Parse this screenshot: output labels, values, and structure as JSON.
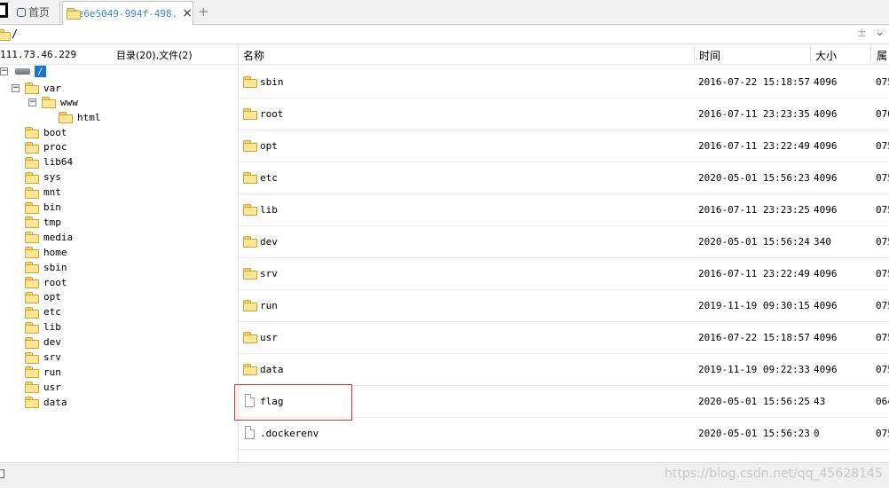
{
  "tabs": {
    "home_label": "首页",
    "active_label": "6e6e5049-994f-498.",
    "close_glyph": "×",
    "add_glyph": "+"
  },
  "path": {
    "value": "/",
    "plusminus_glyph": "±",
    "chevron_glyph": "⌄"
  },
  "left": {
    "server_ip": "111.73.46.229",
    "counts": "目录(20),文件(2)"
  },
  "tree": {
    "root": "/",
    "var": "var",
    "www": "www",
    "html": "html",
    "items": [
      "boot",
      "proc",
      "lib64",
      "sys",
      "mnt",
      "bin",
      "tmp",
      "media",
      "home",
      "sbin",
      "root",
      "opt",
      "etc",
      "lib",
      "dev",
      "srv",
      "run",
      "usr",
      "data"
    ]
  },
  "columns": {
    "name": "名称",
    "time": "时间",
    "size": "大小",
    "perm": "属"
  },
  "files": [
    {
      "name": "sbin",
      "type": "folder",
      "time": "2016-07-22 15:18:57",
      "size": "4096",
      "perm": "075"
    },
    {
      "name": "root",
      "type": "folder",
      "time": "2016-07-11 23:23:35",
      "size": "4096",
      "perm": "070"
    },
    {
      "name": "opt",
      "type": "folder",
      "time": "2016-07-11 23:22:49",
      "size": "4096",
      "perm": "075"
    },
    {
      "name": "etc",
      "type": "folder",
      "time": "2020-05-01 15:56:23",
      "size": "4096",
      "perm": "075"
    },
    {
      "name": "lib",
      "type": "folder",
      "time": "2016-07-11 23:23:25",
      "size": "4096",
      "perm": "075"
    },
    {
      "name": "dev",
      "type": "folder",
      "time": "2020-05-01 15:56:24",
      "size": "340",
      "perm": "075"
    },
    {
      "name": "srv",
      "type": "folder",
      "time": "2016-07-11 23:22:49",
      "size": "4096",
      "perm": "075"
    },
    {
      "name": "run",
      "type": "folder",
      "time": "2019-11-19 09:30:15",
      "size": "4096",
      "perm": "075"
    },
    {
      "name": "usr",
      "type": "folder",
      "time": "2016-07-22 15:18:57",
      "size": "4096",
      "perm": "075"
    },
    {
      "name": "data",
      "type": "folder",
      "time": "2019-11-19 09:22:33",
      "size": "4096",
      "perm": "075"
    },
    {
      "name": "flag",
      "type": "file",
      "time": "2020-05-01 15:56:25",
      "size": "43",
      "perm": "064"
    },
    {
      "name": ".dockerenv",
      "type": "file",
      "time": "2020-05-01 15:56:23",
      "size": "0",
      "perm": "075"
    }
  ],
  "watermark": "https://blog.csdn.net/qq_45628145",
  "icons": {
    "folder": "folder-icon",
    "file": "file-icon",
    "disk": "disk-icon",
    "home": "home-icon"
  },
  "colors": {
    "selection": "#1874d1",
    "active_tab_text": "#3a8bd6",
    "highlight_box": "#dd3333",
    "folder_fill": "#ffe596"
  }
}
